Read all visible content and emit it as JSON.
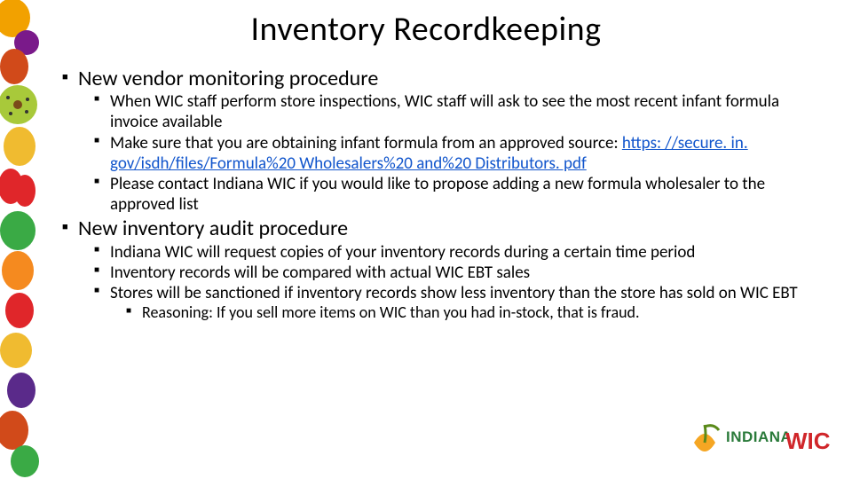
{
  "title": "Inventory Recordkeeping",
  "section1": {
    "heading": "New vendor monitoring procedure",
    "b1": "When WIC staff perform store inspections, WIC staff will ask to see the most recent infant formula invoice available",
    "b2a": "Make sure that you are obtaining infant formula from an approved source: ",
    "b2link": "https: //secure. in. gov/isdh/files/Formula%20 Wholesalers%20 and%20 Distributors. pdf",
    "b3": "Please contact Indiana WIC if you would like to propose adding a new formula wholesaler to the approved list"
  },
  "section2": {
    "heading": "New inventory audit procedure",
    "b1": "Indiana WIC will request copies of your inventory records during a certain time period",
    "b2": "Inventory records will be compared with actual WIC EBT sales",
    "b3": "Stores will be sanctioned if inventory records show less inventory than the store has sold on WIC EBT",
    "sub1": "Reasoning: If you sell more items on WIC than you had in-stock, that is fraud."
  },
  "logo": {
    "text1": "INDIANA",
    "text2": "WIC"
  }
}
